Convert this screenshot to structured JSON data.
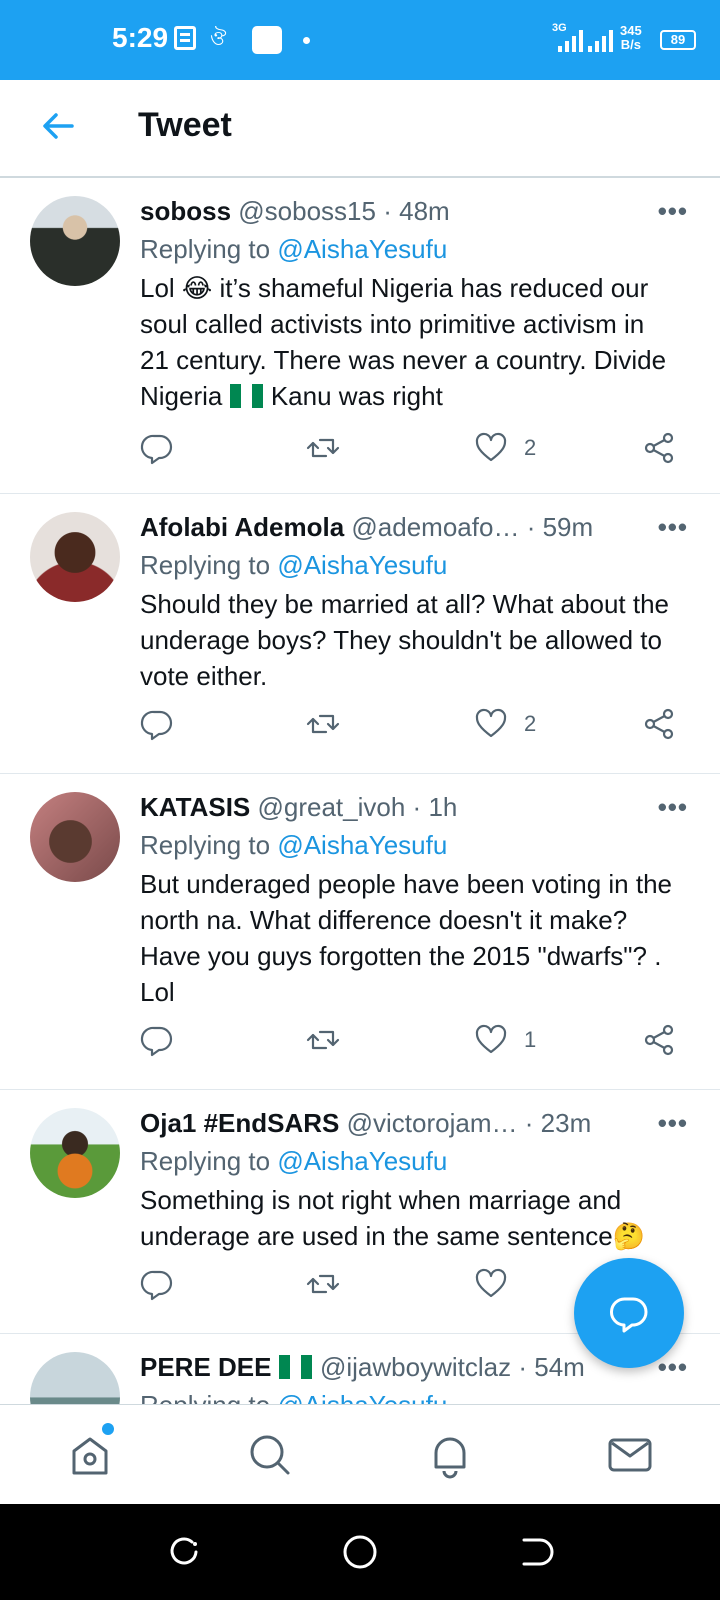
{
  "status_bar": {
    "time": "5:29",
    "network": "3G",
    "speed_value": "345",
    "speed_unit": "B/s",
    "battery": "89"
  },
  "header": {
    "title": "Tweet",
    "back_icon": "arrow-left-icon"
  },
  "tweets": [
    {
      "name": "soboss",
      "handle": "@soboss15",
      "time": "48m",
      "replying_prefix": "Replying to",
      "replying_to": "@AishaYesufu",
      "text_part1": "Lol 😂 it’s shameful Nigeria has reduced our soul called activists into primitive activism in 21 century. There was never a country. Divide Nigeria",
      "text_part2": "Kanu was right",
      "likes": "2",
      "avatar_color": "#3a4a3a"
    },
    {
      "name": "Afolabi Ademola",
      "handle": "@ademoafo…",
      "time": "59m",
      "replying_prefix": "Replying to",
      "replying_to": "@AishaYesufu",
      "text": "Should they be married at all? What about the underage boys? They shouldn't be allowed to vote either.",
      "likes": "2",
      "avatar_color": "#8a3a3a"
    },
    {
      "name": "KATASIS",
      "handle": "@great_ivoh",
      "time": "1h",
      "replying_prefix": "Replying to",
      "replying_to": "@AishaYesufu",
      "text": "But underaged people have been voting in the north na. What difference doesn't it make? Have you guys forgotten the 2015 \"dwarfs\"? . Lol",
      "likes": "1",
      "avatar_color": "#a06a6a"
    },
    {
      "name": "Oja1 #EndSARS",
      "handle": "@victorojam…",
      "time": "23m",
      "replying_prefix": "Replying to",
      "replying_to": "@AishaYesufu",
      "text": "Something is not right when marriage and underage are used in the same sentence🤔",
      "likes": "",
      "avatar_color": "#4a7a3a"
    },
    {
      "name": "PERE DEE",
      "handle": "@ijawboywitclaz",
      "time": "54m",
      "replying_prefix": "Replying to",
      "replying_to": "@AishaYesufu",
      "avatar_color": "#8aa0a8"
    }
  ],
  "icons": {
    "reply": "reply-icon",
    "retweet": "retweet-icon",
    "like": "heart-icon",
    "share": "share-icon",
    "more": "more-icon"
  },
  "more_glyph": "•••",
  "bottom_nav": [
    "home-icon",
    "search-icon",
    "bell-icon",
    "mail-icon"
  ],
  "colors": {
    "brand": "#1da1f2",
    "mention": "#1b95e0",
    "secondary_text": "#536471"
  }
}
